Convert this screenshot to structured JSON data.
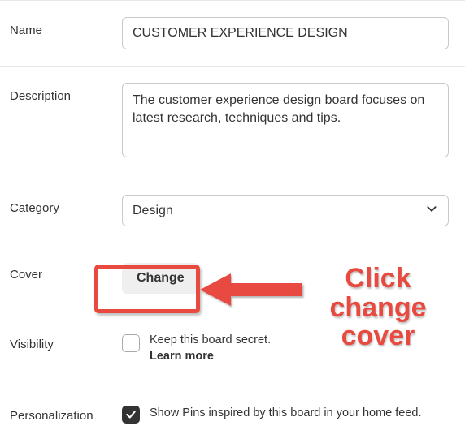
{
  "form": {
    "name_label": "Name",
    "name_value": "CUSTOMER EXPERIENCE DESIGN",
    "description_label": "Description",
    "description_value": "The customer experience design board focuses on latest research, techniques and tips.",
    "category_label": "Category",
    "category_value": "Design",
    "cover_label": "Cover",
    "change_button": "Change",
    "visibility_label": "Visibility",
    "visibility_text": "Keep this board secret.",
    "visibility_learn_more": "Learn more",
    "visibility_checked": false,
    "personalization_label": "Personalization",
    "personalization_text": "Show Pins inspired by this board in your home feed.",
    "personalization_checked": true
  },
  "annotation": {
    "text_line1": "Click",
    "text_line2": "change",
    "text_line3": "cover",
    "highlight_color": "#e84a3f"
  }
}
